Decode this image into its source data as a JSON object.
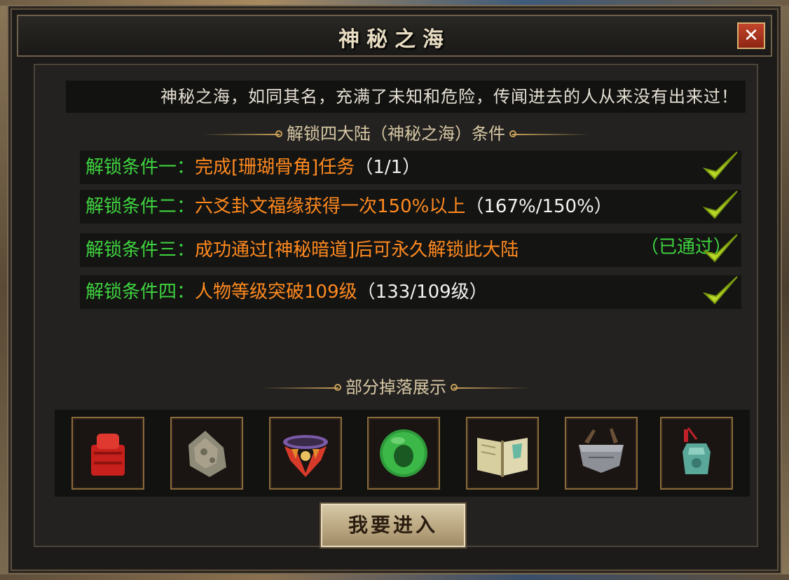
{
  "window": {
    "title": "神秘之海",
    "close_label": "✕"
  },
  "intro_text": "神秘之海，如同其名，充满了未知和危险，传闻进去的人从来没有出来过！",
  "conditions_heading": "解锁四大陆（神秘之海）条件",
  "conditions": [
    {
      "label": "解锁条件一：",
      "description": "完成[珊瑚骨角]任务",
      "progress": "（1/1）",
      "status": "",
      "completed": true
    },
    {
      "label": "解锁条件二：",
      "description": "六爻卦文福缘获得一次150%以上",
      "progress": "（167%/150%）",
      "status": "",
      "completed": true
    },
    {
      "label": "解锁条件三：",
      "description": "成功通过[神秘暗道]后可永久解锁此大陆",
      "progress": "",
      "status": "（已通过）",
      "completed": true
    },
    {
      "label": "解锁条件四：",
      "description": "人物等级突破109级",
      "progress": "（133/109级）",
      "status": "",
      "completed": true
    }
  ],
  "drops_heading": "部分掉落展示",
  "drop_items": [
    {
      "icon": "red-seal-icon"
    },
    {
      "icon": "stone-ore-icon"
    },
    {
      "icon": "ornate-belt-icon"
    },
    {
      "icon": "jade-ring-icon"
    },
    {
      "icon": "open-book-icon"
    },
    {
      "icon": "iron-armor-icon"
    },
    {
      "icon": "jade-pendant-icon"
    }
  ],
  "enter_button_label": "我要进入",
  "colors": {
    "condition_label": "#3fd33f",
    "condition_desc": "#ff8a1f",
    "progress": "#f2f2f2",
    "check": "#b8d828"
  }
}
